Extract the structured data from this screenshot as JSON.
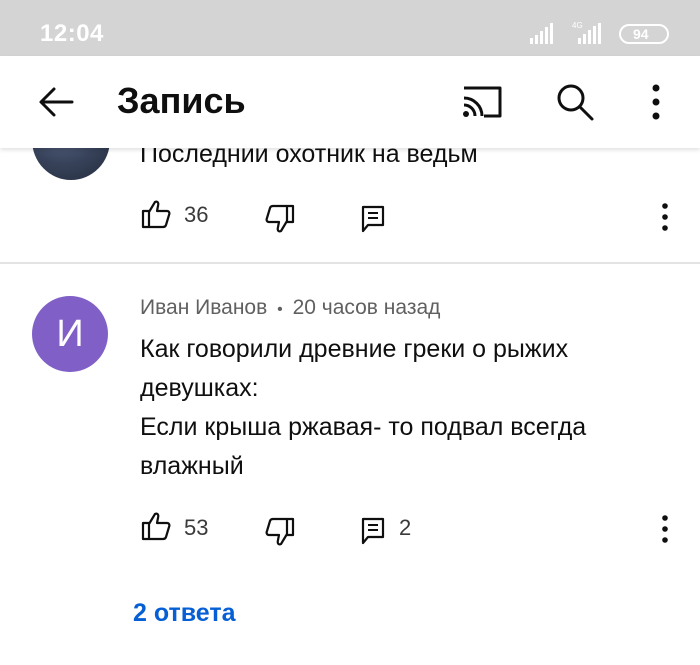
{
  "status_bar": {
    "time": "12:04",
    "battery": "94",
    "network": "4G"
  },
  "app_bar": {
    "title": "Запись",
    "icons": [
      "back-arrow-icon",
      "cast-icon",
      "search-icon",
      "more-vert-icon"
    ]
  },
  "previous_comment": {
    "text_fragment": "Последний охотник на ведьм",
    "likes": "36"
  },
  "comment": {
    "avatar_letter": "И",
    "author": "Иван Иванов",
    "separator": "•",
    "time": "20 часов назад",
    "lines": [
      "Как говорили древние греки о рыжих",
      "девушках:",
      "Если крыша ржавая- то подвал всегда",
      "влажный"
    ],
    "likes": "53",
    "reply_count": "2",
    "replies_link": "2 ответа"
  },
  "colors": {
    "avatar": "#8060c6",
    "link": "#065fd4",
    "status_bar": "#d4d4d4"
  }
}
